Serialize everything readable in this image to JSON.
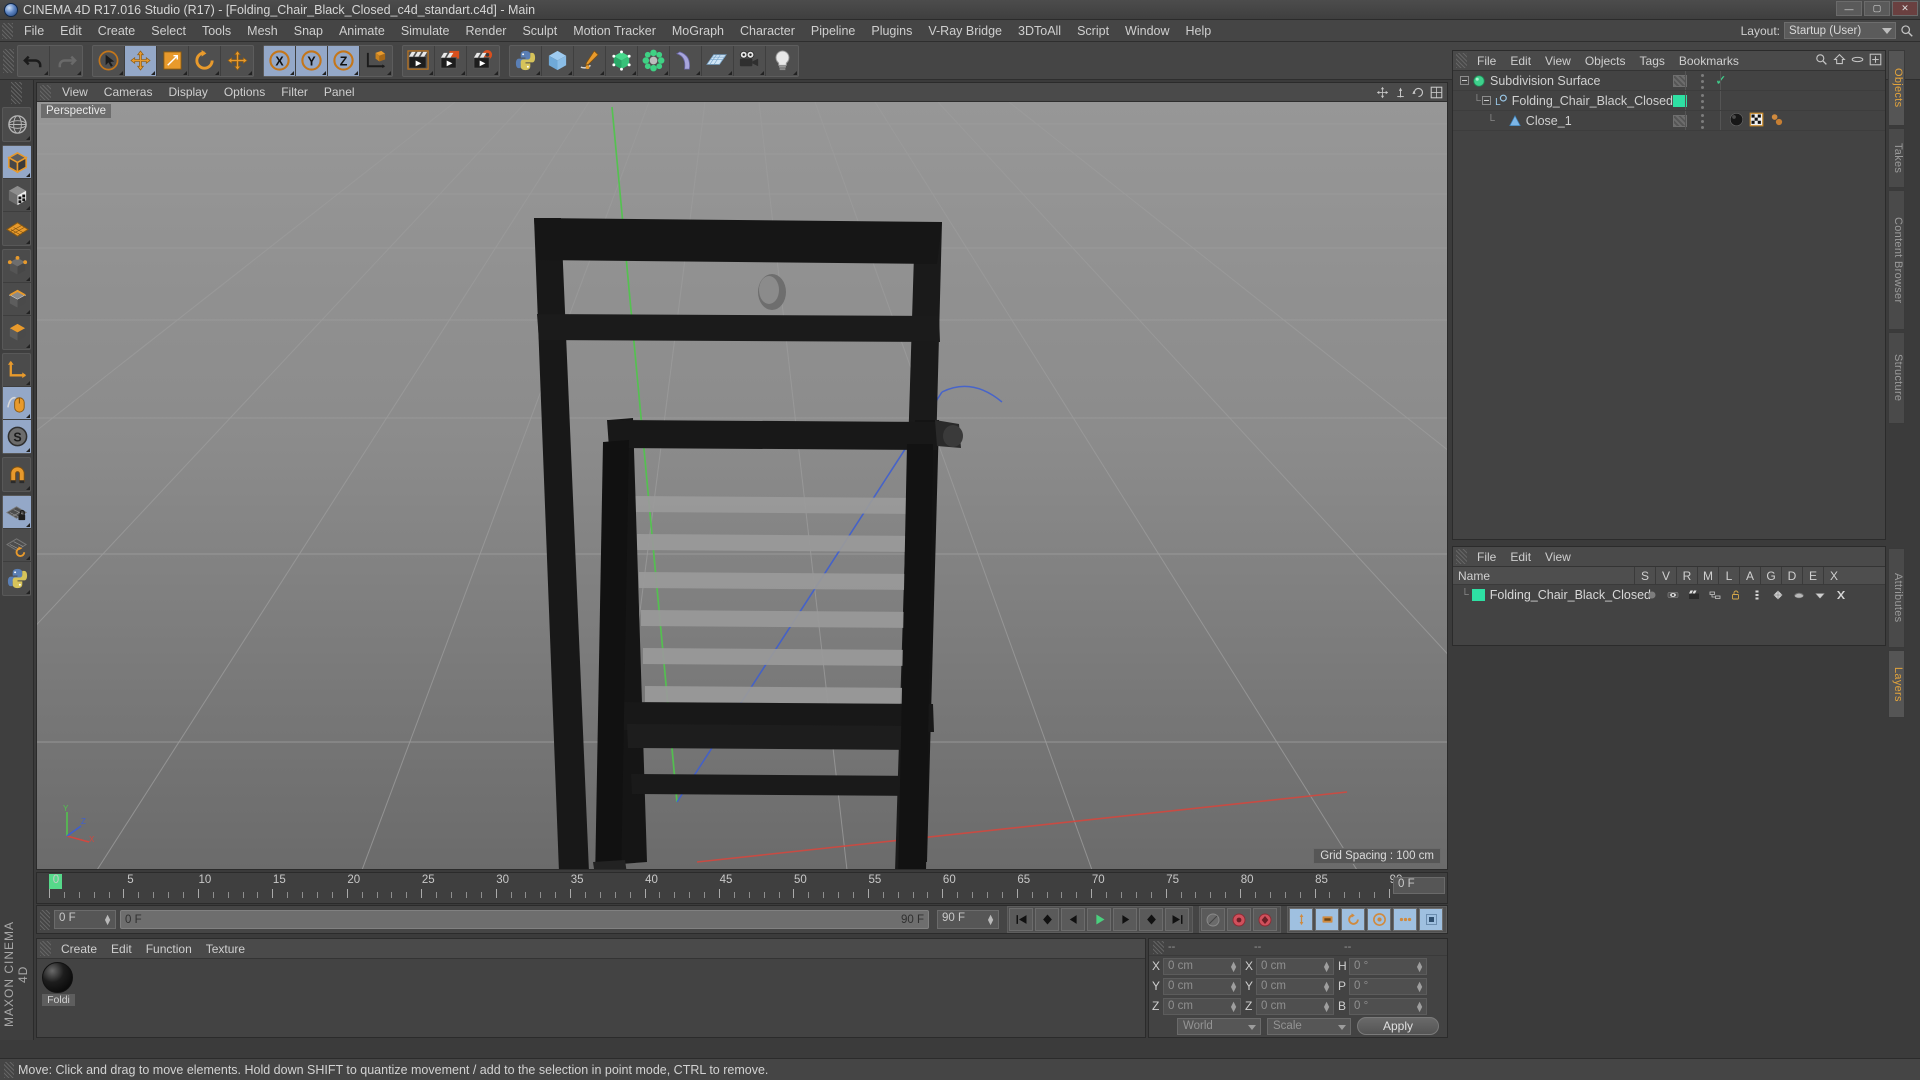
{
  "window": {
    "title": "CINEMA 4D R17.016 Studio (R17) - [Folding_Chair_Black_Closed_c4d_standart.c4d] - Main",
    "minimize": "—",
    "maximize": "▢",
    "close": "✕"
  },
  "menubar": {
    "items": [
      "File",
      "Edit",
      "Create",
      "Select",
      "Tools",
      "Mesh",
      "Snap",
      "Animate",
      "Simulate",
      "Render",
      "Sculpt",
      "Motion Tracker",
      "MoGraph",
      "Character",
      "Pipeline",
      "Plugins",
      "V-Ray Bridge",
      "3DToAll",
      "Script",
      "Window",
      "Help"
    ],
    "layout_label": "Layout:",
    "layout_value": "Startup (User)",
    "search_icon": "search-icon"
  },
  "toolbar": {
    "groups": [
      {
        "name": "undo-redo",
        "buttons": [
          {
            "name": "undo-button",
            "icon": "undo-arrow-icon",
            "active": false
          },
          {
            "name": "redo-button",
            "icon": "redo-arrow-icon",
            "active": false
          }
        ]
      },
      {
        "name": "transform-tools",
        "buttons": [
          {
            "name": "live-selection-tool",
            "icon": "cursor-circle-icon",
            "active": false
          },
          {
            "name": "move-tool",
            "icon": "move-cross-icon",
            "active": true
          },
          {
            "name": "scale-tool",
            "icon": "scale-box-icon",
            "active": false
          },
          {
            "name": "rotate-tool",
            "icon": "rotate-circle-icon",
            "active": false
          },
          {
            "name": "move-duplicate-tool",
            "icon": "move-cross-icon",
            "active": false
          }
        ]
      },
      {
        "name": "axis-locks",
        "buttons": [
          {
            "name": "lock-x-axis",
            "icon": "x-axis-icon",
            "active": true
          },
          {
            "name": "lock-y-axis",
            "icon": "y-axis-icon",
            "active": true
          },
          {
            "name": "lock-z-axis",
            "icon": "z-axis-icon",
            "active": true
          },
          {
            "name": "world-object-coordinates",
            "icon": "world-axis-cube-icon",
            "active": false
          }
        ]
      },
      {
        "name": "render-group",
        "buttons": [
          {
            "name": "render-view-button",
            "icon": "clapperboard-frame-icon",
            "active": false
          },
          {
            "name": "render-to-picture-viewer-button",
            "icon": "clapperboard-picture-icon",
            "active": false
          },
          {
            "name": "render-settings-button",
            "icon": "clapperboard-gear-icon",
            "active": false
          }
        ]
      },
      {
        "name": "create-group",
        "buttons": [
          {
            "name": "python-generator-button",
            "icon": "python-icon",
            "active": false
          },
          {
            "name": "add-cube-button",
            "icon": "cube-icon",
            "active": false
          },
          {
            "name": "add-spline-button",
            "icon": "pen-spline-icon",
            "active": false
          },
          {
            "name": "add-generator-button",
            "icon": "green-cube-nurbs-icon",
            "active": false
          },
          {
            "name": "add-array-button",
            "icon": "mograph-cluster-icon",
            "active": false
          },
          {
            "name": "add-deformer-button",
            "icon": "bend-deformer-icon",
            "active": false
          },
          {
            "name": "add-environment-button",
            "icon": "floor-grid-icon",
            "active": false
          },
          {
            "name": "add-camera-button",
            "icon": "camera-icon",
            "active": false
          },
          {
            "name": "add-light-button",
            "icon": "light-bulb-icon",
            "active": false
          }
        ]
      }
    ]
  },
  "left_tools": {
    "groups": [
      [
        {
          "name": "make-editable-tool",
          "icon": "globe-editable-icon",
          "active": false
        }
      ],
      [
        {
          "name": "model-mode",
          "icon": "model-cube-icon",
          "active": true
        },
        {
          "name": "texture-mode",
          "icon": "texture-checker-cube-icon",
          "active": false
        },
        {
          "name": "workplane-mode",
          "icon": "orange-grid-plane-icon",
          "active": false
        }
      ],
      [
        {
          "name": "points-mode",
          "icon": "points-cube-icon",
          "active": false
        },
        {
          "name": "edges-mode",
          "icon": "edges-cube-icon",
          "active": false
        },
        {
          "name": "polygons-mode",
          "icon": "polygon-cube-icon",
          "active": false
        }
      ],
      [
        {
          "name": "object-axis-mode",
          "icon": "axis-corner-icon",
          "active": false
        },
        {
          "name": "enable-axis-mode",
          "icon": "mouse-axis-icon",
          "active": true
        },
        {
          "name": "soft-selection-mode",
          "icon": "soft-selection-s-icon",
          "active": true
        }
      ],
      [
        {
          "name": "enable-snap",
          "icon": "magnet-icon",
          "active": false
        }
      ],
      [
        {
          "name": "lock-workplane",
          "icon": "grid-lock-icon",
          "active": true
        },
        {
          "name": "planar-workplane",
          "icon": "grid-rotate-icon",
          "active": false
        },
        {
          "name": "python-console",
          "icon": "python-icon",
          "active": false
        }
      ]
    ],
    "branding": "MAXON CINEMA 4D"
  },
  "viewport": {
    "menu": [
      "View",
      "Cameras",
      "Display",
      "Options",
      "Filter",
      "Panel"
    ],
    "perspective_label": "Perspective",
    "grid_spacing": "Grid Spacing : 100 cm",
    "axis_gizmo": {
      "y_label": "Y",
      "x_label": "X",
      "z_label": "Z"
    },
    "corner_icons": [
      "move-view-icon",
      "scale-view-icon",
      "rotate-view-icon",
      "four-view-icon"
    ]
  },
  "object_manager": {
    "menu": [
      "File",
      "Edit",
      "View",
      "Objects",
      "Tags",
      "Bookmarks"
    ],
    "icons": [
      "search-icon",
      "home-icon",
      "ellipse-icon",
      "fit-icon"
    ],
    "tab_label": "Objects",
    "rows": [
      {
        "name": "Subdivision Surface",
        "icon": "subdivision-surface-icon",
        "indent": 0,
        "expander": "minus",
        "visible_dots": true,
        "check": true,
        "color": null,
        "tags": []
      },
      {
        "name": "Folding_Chair_Black_Closed",
        "icon": "polygon-object-icon",
        "indent": 1,
        "expander": "minus",
        "visible_dots": true,
        "check": false,
        "color": "#2ee0a3",
        "tags": []
      },
      {
        "name": "Close_1",
        "icon": "light-cone-icon",
        "indent": 2,
        "expander": "none",
        "visible_dots": true,
        "check": false,
        "color": null,
        "tags": [
          "material-tag-icon",
          "texture-checker-tag-icon",
          "uv-tag-icon"
        ]
      }
    ]
  },
  "vertical_tabs_top": [
    "Objects",
    "Takes",
    "Content Browser",
    "Structure"
  ],
  "vertical_tabs_bottom": [
    "Attributes",
    "Layers"
  ],
  "layer_manager": {
    "menu": [
      "File",
      "Edit",
      "View"
    ],
    "header_name": "Name",
    "columns": [
      "S",
      "V",
      "R",
      "M",
      "L",
      "A",
      "G",
      "D",
      "E",
      "X"
    ],
    "rows": [
      {
        "name": "Folding_Chair_Black_Closed",
        "color": "#2ee0a3",
        "icons": [
          "solo-dot-icon",
          "visible-eye-icon",
          "render-clapper-icon",
          "manager-icon",
          "lock-open-icon",
          "animation-icon",
          "generator-icon",
          "deformer-icon",
          "expression-icon",
          "xref-icon"
        ]
      }
    ]
  },
  "timeline": {
    "ticks": [
      0,
      5,
      10,
      15,
      20,
      25,
      30,
      35,
      40,
      45,
      50,
      55,
      60,
      65,
      70,
      75,
      80,
      85,
      90
    ],
    "min": 0,
    "max": 90,
    "current_frame_field": "0 F"
  },
  "transport": {
    "current_frame": "0 F",
    "range_start": "0 F",
    "range_end": "90 F",
    "max_frame": "90 F",
    "buttons": [
      {
        "name": "go-to-start-button",
        "icon": "skip-start-icon"
      },
      {
        "name": "go-to-previous-key-button",
        "icon": "prev-key-icon"
      },
      {
        "name": "go-to-previous-frame-button",
        "icon": "step-back-icon"
      },
      {
        "name": "play-button",
        "icon": "play-icon"
      },
      {
        "name": "go-to-next-frame-button",
        "icon": "step-forward-icon"
      },
      {
        "name": "go-to-next-key-button",
        "icon": "next-key-icon"
      },
      {
        "name": "go-to-end-button",
        "icon": "skip-end-icon"
      }
    ],
    "record_buttons": [
      {
        "name": "autokeying-button",
        "icon": "autokey-circle-icon"
      },
      {
        "name": "record-active-objects-button",
        "icon": "record-red-icon"
      },
      {
        "name": "record-keyframe-selection-button",
        "icon": "keyframe-red-icon"
      }
    ],
    "key_toggles": [
      {
        "name": "position-key-toggle",
        "icon": "position-key-icon"
      },
      {
        "name": "scale-key-toggle",
        "icon": "scale-key-icon"
      },
      {
        "name": "rotation-key-toggle",
        "icon": "rotation-key-icon"
      },
      {
        "name": "param-key-toggle",
        "icon": "param-key-icon"
      },
      {
        "name": "pla-key-toggle",
        "icon": "pla-key-icon"
      },
      {
        "name": "keyframe-selection-toggle",
        "icon": "key-select-icon"
      }
    ]
  },
  "material_manager": {
    "menu": [
      "Create",
      "Edit",
      "Function",
      "Texture"
    ],
    "materials": [
      {
        "name": "Foldi",
        "preview": "black-sphere-preview"
      }
    ]
  },
  "coordinate_manager": {
    "headers": [
      "--",
      "--",
      "--"
    ],
    "rows": [
      {
        "pos_label": "X",
        "pos_value": "0 cm",
        "size_label": "X",
        "size_value": "0 cm",
        "rot_label": "H",
        "rot_value": "0 °"
      },
      {
        "pos_label": "Y",
        "pos_value": "0 cm",
        "size_label": "Y",
        "size_value": "0 cm",
        "rot_label": "P",
        "rot_value": "0 °"
      },
      {
        "pos_label": "Z",
        "pos_value": "0 cm",
        "size_label": "Z",
        "size_value": "0 cm",
        "rot_label": "B",
        "rot_value": "0 °"
      }
    ],
    "system": "World",
    "mode": "Scale",
    "apply": "Apply"
  },
  "statusbar": {
    "message": "Move: Click and drag to move elements. Hold down SHIFT to quantize movement / add to the selection in point mode, CTRL to remove."
  },
  "colors": {
    "accent_orange": "#e8a33d",
    "active_blue": "#94a8c8",
    "green_mat": "#2ee0a3",
    "panel_bg": "#434343",
    "chrome_bg": "#454545"
  }
}
